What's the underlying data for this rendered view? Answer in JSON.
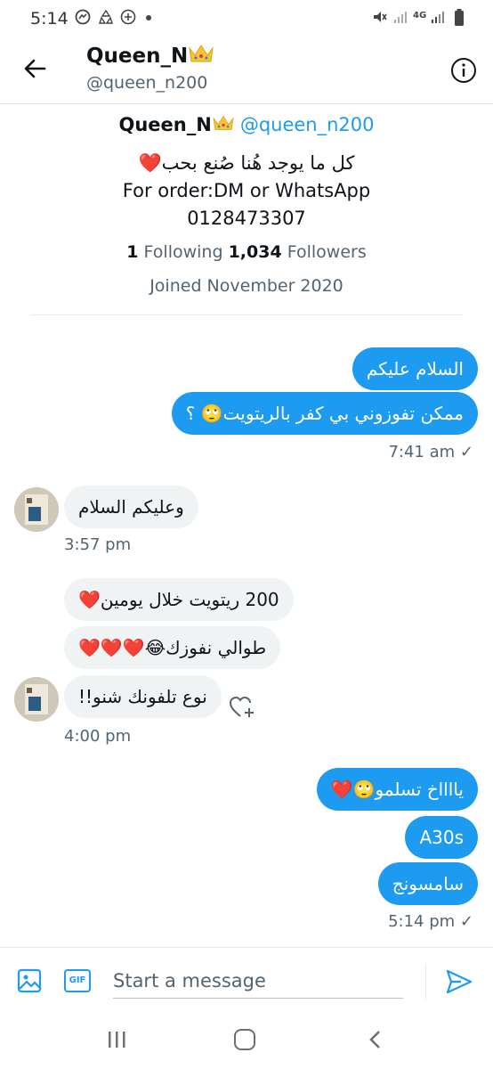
{
  "status_bar": {
    "time": "5:14",
    "network": "4G"
  },
  "header": {
    "name": "Queen_N",
    "handle": "@queen_n200"
  },
  "profile": {
    "name": "Queen_N",
    "handle": "@queen_n200",
    "bio_line1": "كل ما يوجد هُنا صُنع بحب",
    "bio_line2": "For order:DM or WhatsApp",
    "bio_line3": "0128473307",
    "following_count": "1",
    "following_label": "Following",
    "followers_count": "1,034",
    "followers_label": "Followers",
    "joined": "Joined November 2020"
  },
  "messages": [
    {
      "direction": "out",
      "text": "السلام عليكم"
    },
    {
      "direction": "out",
      "text": "ممكن تفوزوني بي كفر بالريتويت🙄 ؟",
      "time": "7:41 am",
      "status": "✓"
    },
    {
      "direction": "in",
      "text": "وعليكم السلام",
      "time": "3:57 pm"
    },
    {
      "direction": "in",
      "text": "200 ريتويت خلال يومين❤️"
    },
    {
      "direction": "in",
      "text": "طوالي نفوزك😂❤️❤️❤️"
    },
    {
      "direction": "in",
      "text": "نوع تلفونك شنو!!",
      "time": "4:00 pm"
    },
    {
      "direction": "out",
      "text": "يااااخ تسلمو🙄❤️"
    },
    {
      "direction": "out",
      "text": "A30s"
    },
    {
      "direction": "out",
      "text": "سامسونج",
      "time": "5:14 pm",
      "status": "✓"
    }
  ],
  "composer": {
    "placeholder": "Start a message",
    "gif_label": "GIF"
  },
  "colors": {
    "accent": "#1d9bf0",
    "incoming_bubble": "#eff3f4",
    "secondary_text": "#536471"
  }
}
